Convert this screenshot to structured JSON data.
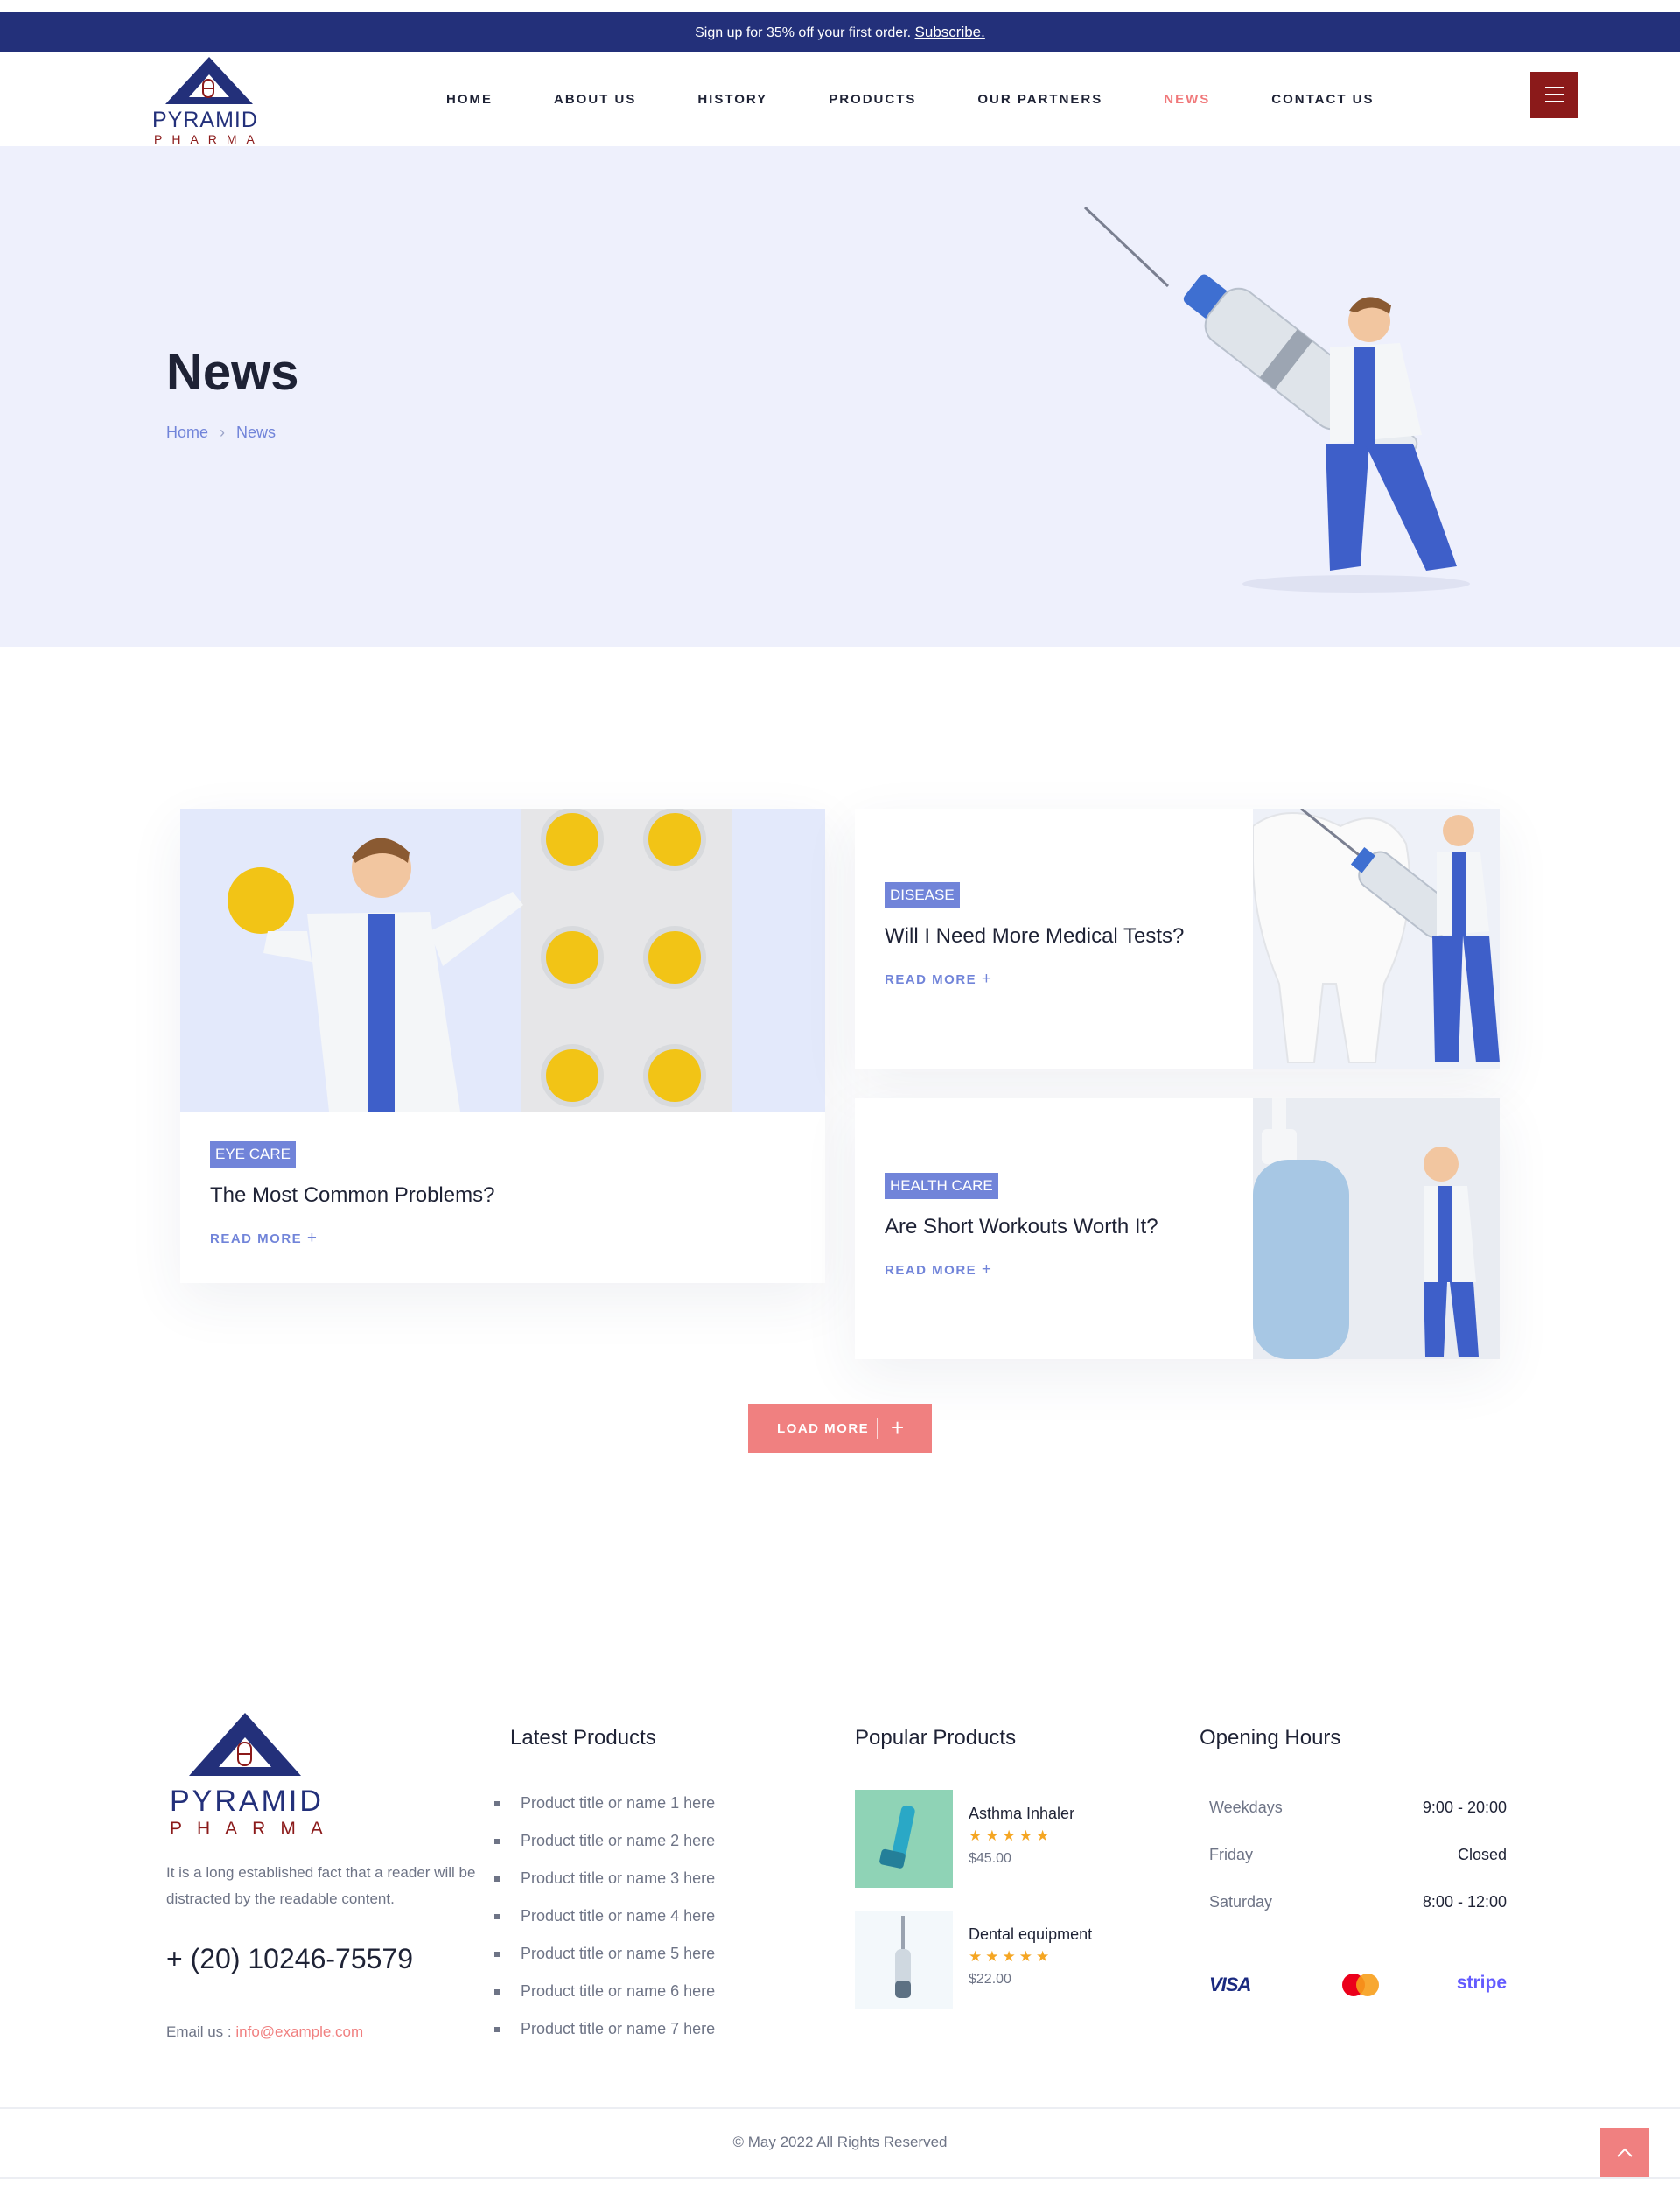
{
  "topbar": {
    "text": "Sign up for 35% off your first order.",
    "link": "Subscribe."
  },
  "brand": {
    "word1": "PYRAMID",
    "word2": "PHARMA"
  },
  "nav": {
    "items": [
      "HOME",
      "ABOUT US",
      "HISTORY",
      "PRODUCTS",
      "OUR PARTNERS",
      "NEWS",
      "CONTACT US"
    ],
    "active": "NEWS"
  },
  "hero": {
    "title": "News",
    "breadcrumb": [
      "Home",
      "News"
    ]
  },
  "posts": [
    {
      "category": "EYE CARE",
      "title": "The Most Common Problems?",
      "cta": "READ MORE"
    },
    {
      "category": "DISEASE",
      "title": "Will I Need More Medical Tests?",
      "cta": "READ MORE"
    },
    {
      "category": "HEALTH CARE",
      "title": "Are Short Workouts Worth It?",
      "cta": "READ MORE"
    }
  ],
  "load_more": "LOAD MORE",
  "footer": {
    "about": "It is a long established fact that a reader will be distracted by the readable content.",
    "phone": "+ (20) 10246-75579",
    "email_label": "Email us :",
    "email": "info@example.com",
    "latest_title": "Latest Products",
    "latest": [
      "Product title or name 1 here",
      "Product title or name 2 here",
      "Product title or name 3 here",
      "Product title or name 4 here",
      "Product title or name 5 here",
      "Product title or name 6 here",
      "Product title or name 7 here"
    ],
    "popular_title": "Popular Products",
    "popular": [
      {
        "name": "Asthma Inhaler",
        "rating": 5,
        "price": "$45.00"
      },
      {
        "name": "Dental equipment",
        "rating": 5,
        "price": "$22.00"
      }
    ],
    "hours_title": "Opening Hours",
    "hours": [
      {
        "day": "Weekdays",
        "time": "9:00 - 20:00"
      },
      {
        "day": "Friday",
        "time": "Closed"
      },
      {
        "day": "Saturday",
        "time": "8:00 - 12:00"
      }
    ],
    "payments": [
      "VISA",
      "stripe"
    ],
    "copyright": "© May 2022 All Rights Reserved"
  },
  "colors": {
    "navy": "#23307a",
    "accent": "#f08080",
    "maroon": "#8b1a1a",
    "badge": "#7184d9",
    "hero_bg": "#eef0fc",
    "star": "#f5a623"
  }
}
